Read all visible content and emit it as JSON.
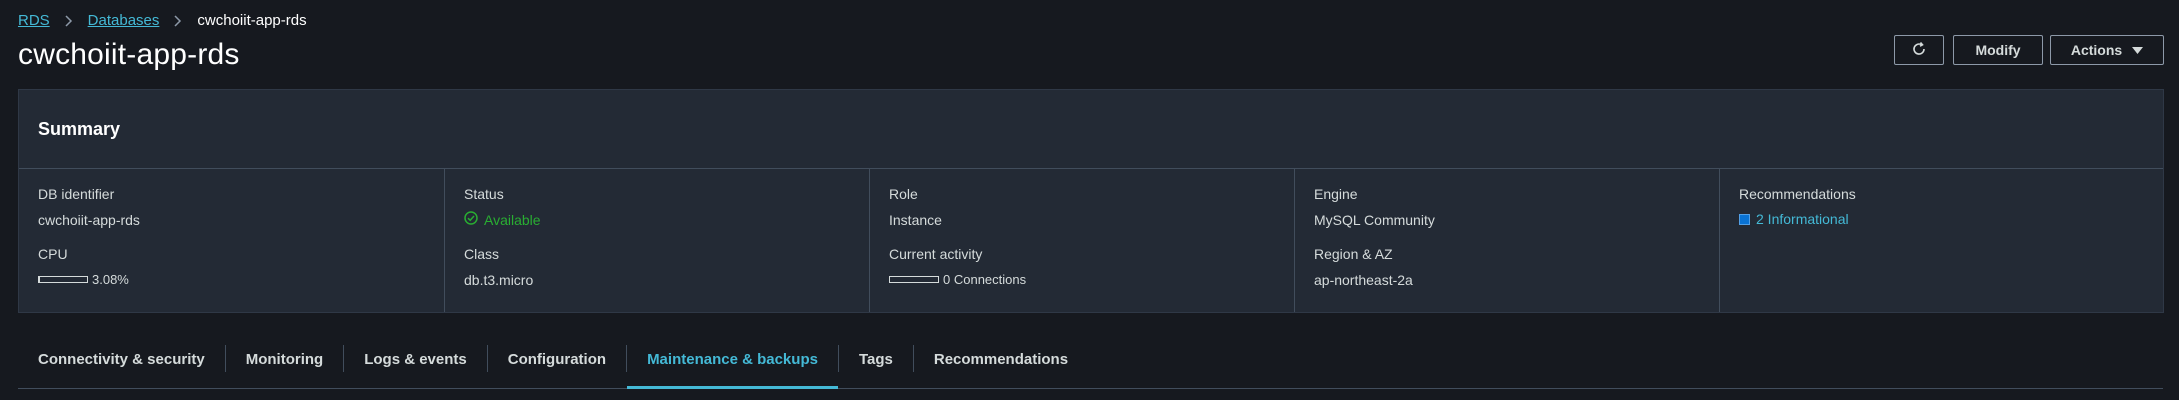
{
  "breadcrumb": {
    "items": [
      {
        "label": "RDS",
        "link": true
      },
      {
        "label": "Databases",
        "link": true
      },
      {
        "label": "cwchoiit-app-rds",
        "link": false
      }
    ]
  },
  "page_title": "cwchoiit-app-rds",
  "header_buttons": {
    "refresh_icon": "refresh-icon",
    "modify": "Modify",
    "actions": "Actions"
  },
  "summary": {
    "title": "Summary",
    "columns": [
      {
        "label1": "DB identifier",
        "value1": "cwchoiit-app-rds",
        "label2": "CPU",
        "value2": "3.08%",
        "cpu_fraction": 0.0308
      },
      {
        "label1": "Status",
        "value1": "Available",
        "status_color": "#29ad32",
        "label2": "Class",
        "value2": "db.t3.micro"
      },
      {
        "label1": "Role",
        "value1": "Instance",
        "label2": "Current activity",
        "value2": "0 Connections",
        "activity_fraction": 0
      },
      {
        "label1": "Engine",
        "value1": "MySQL Community",
        "label2": "Region & AZ",
        "value2": "ap-northeast-2a"
      },
      {
        "label1": "Recommendations",
        "value1": "2 Informational",
        "info_color": "#0972d3"
      }
    ]
  },
  "tabs": [
    {
      "label": "Connectivity & security",
      "active": false
    },
    {
      "label": "Monitoring",
      "active": false
    },
    {
      "label": "Logs & events",
      "active": false
    },
    {
      "label": "Configuration",
      "active": false
    },
    {
      "label": "Maintenance & backups",
      "active": true
    },
    {
      "label": "Tags",
      "active": false
    },
    {
      "label": "Recommendations",
      "active": false
    }
  ],
  "colors": {
    "accent": "#44b9d6",
    "background": "#16191f",
    "panel": "#232a35"
  }
}
